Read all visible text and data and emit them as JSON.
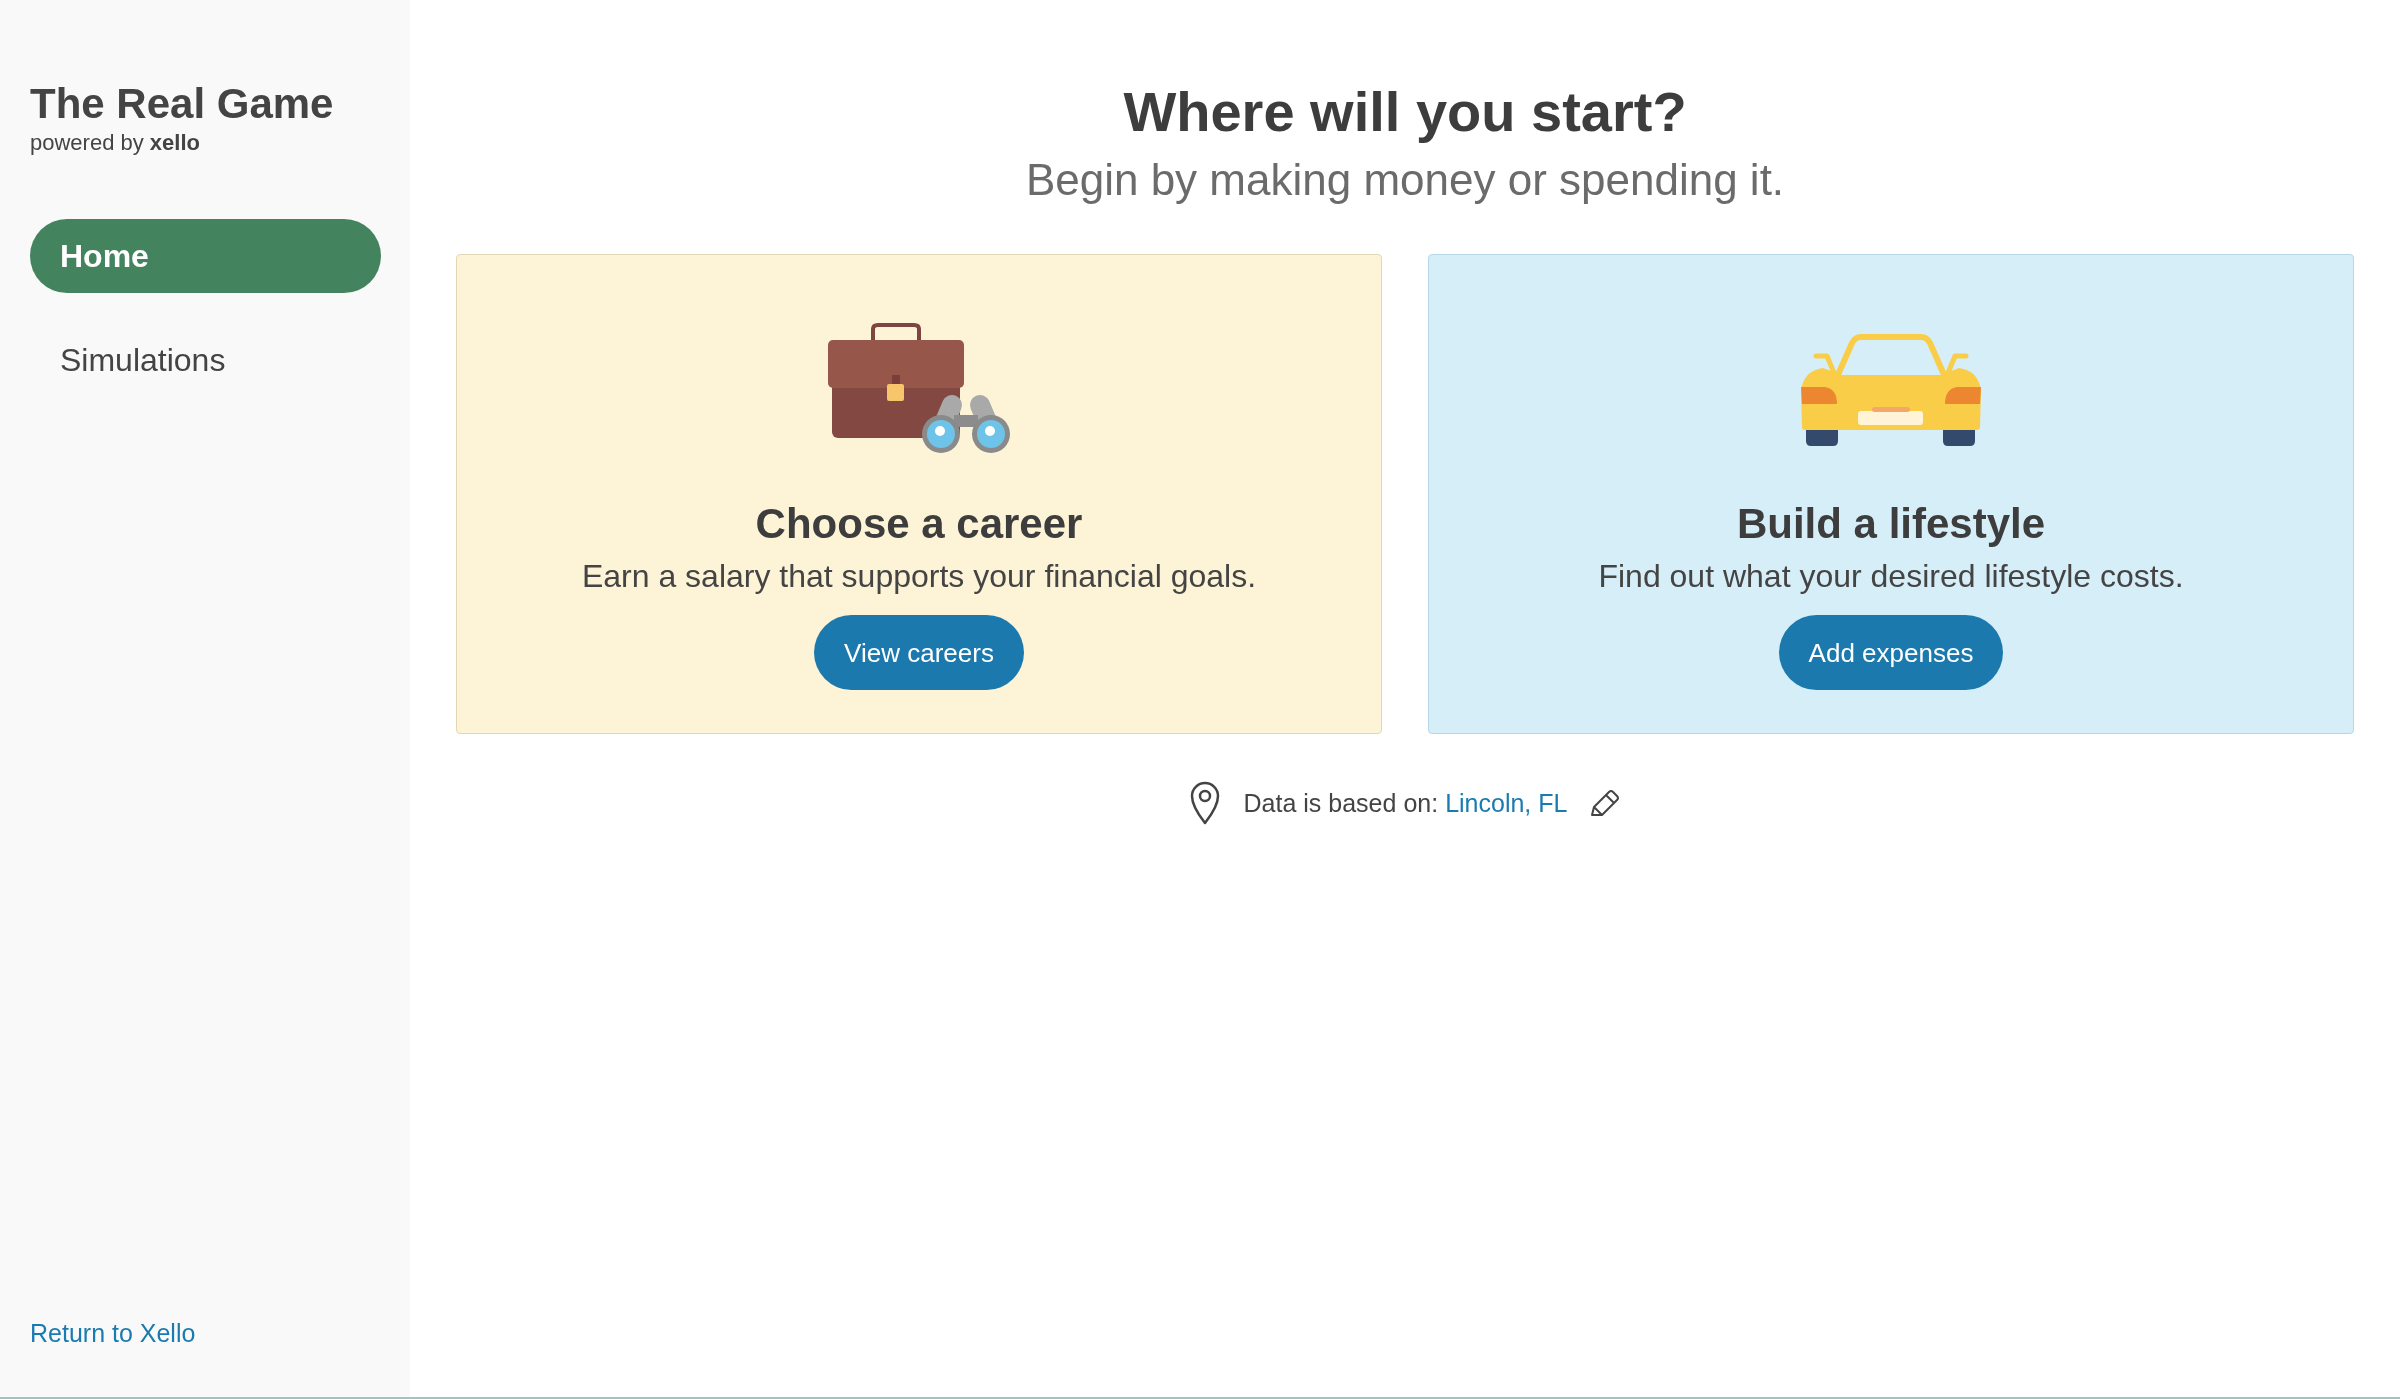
{
  "sidebar": {
    "app_title": "The Real Game",
    "powered_by": "powered by **xello**",
    "nav_items": [
      {
        "label": "Home",
        "selected": true
      },
      {
        "label": "Simulations",
        "selected": false
      }
    ],
    "footer_link": "Return to Xello"
  },
  "main": {
    "heading": "Where will you start?",
    "subheading": "Begin by making money or spending it.",
    "cards": [
      {
        "kind": "career",
        "title": "Choose a career",
        "description": "Earn a salary that supports your financial goals.",
        "button": "View careers"
      },
      {
        "kind": "lifestyle",
        "title": "Build a lifestyle",
        "description": "Find out what your desired lifestyle costs.",
        "button": "Add expenses"
      }
    ],
    "location": {
      "label": "Data is based on:",
      "value": "Lincoln, FL"
    }
  }
}
